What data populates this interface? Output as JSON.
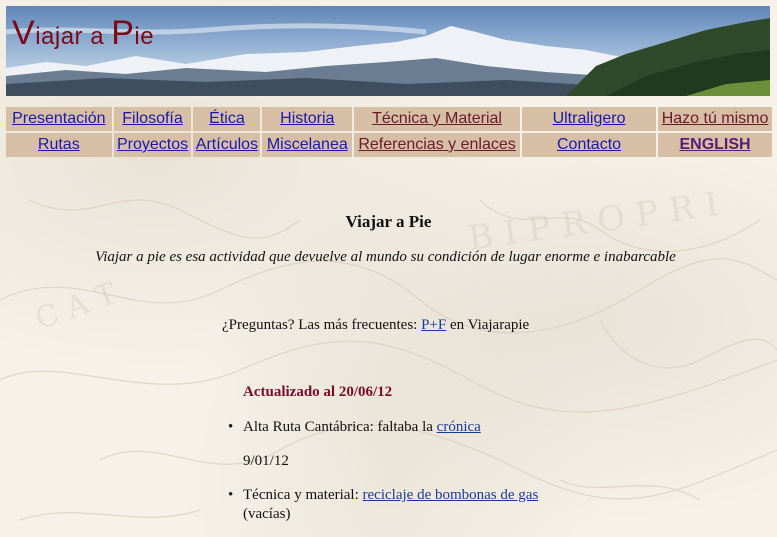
{
  "banner": {
    "title_first_initial": "V",
    "title_part1": "iajar a ",
    "title_second_initial": "P",
    "title_part2": "ie"
  },
  "nav": {
    "row1": [
      "Presentación",
      "Filosofía",
      "Ética",
      "Historia",
      "Técnica y Material",
      "Ultraligero",
      "Hazo tú mismo"
    ],
    "row2": [
      "Rutas",
      "Proyectos",
      "Artículos",
      "Miscelanea",
      "Referencias y enlaces",
      "Contacto",
      "ENGLISH"
    ]
  },
  "main": {
    "title": "Viajar a Pie",
    "tagline": "Viajar a pie es esa actividad que devuelve al mundo su condición de lugar enorme e inabarcable",
    "faq_prefix": "¿Preguntas? Las más frecuentes: ",
    "faq_link": "P+F",
    "faq_suffix": " en Viajarapie",
    "updated": "Actualizado al 20/06/12",
    "news": [
      {
        "text": "Alta Ruta Cantábrica: faltaba la ",
        "link": "crónica"
      },
      {
        "text": "Técnica y material: ",
        "link": "reciclaje de bombonas de gas",
        "continuation": "(vacías)"
      }
    ],
    "news_date": "9/01/12"
  },
  "colors": {
    "nav_cell": "#d7bfa6",
    "title_red": "#7a0a18",
    "updated_red": "#7a0a2a",
    "link_blue": "#1a1aa6"
  }
}
